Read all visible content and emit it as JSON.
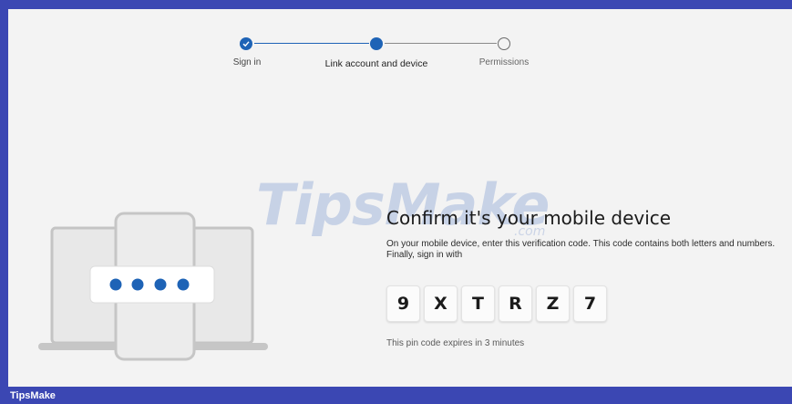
{
  "stepper": {
    "steps": [
      {
        "label": "Sign in",
        "state": "done"
      },
      {
        "label": "Link account and device",
        "state": "current"
      },
      {
        "label": "Permissions",
        "state": "todo"
      }
    ]
  },
  "watermark": {
    "text": "TipsMake",
    "sub": ".com"
  },
  "main": {
    "title": "Confirm it's your mobile device",
    "description": "On your mobile device, enter this verification code. This code contains both letters and numbers. Finally, sign in with",
    "code": [
      "9",
      "X",
      "T",
      "R",
      "Z",
      "7"
    ],
    "expiry": "This pin code expires in 3 minutes"
  },
  "footer": {
    "brand": "TipsMake"
  },
  "colors": {
    "accent": "#1e63b6",
    "frame": "#3b47b3",
    "background": "#f3f3f3"
  },
  "illustration": {
    "icon": "laptop-phone-pin-icon",
    "pin_dots": 4
  }
}
